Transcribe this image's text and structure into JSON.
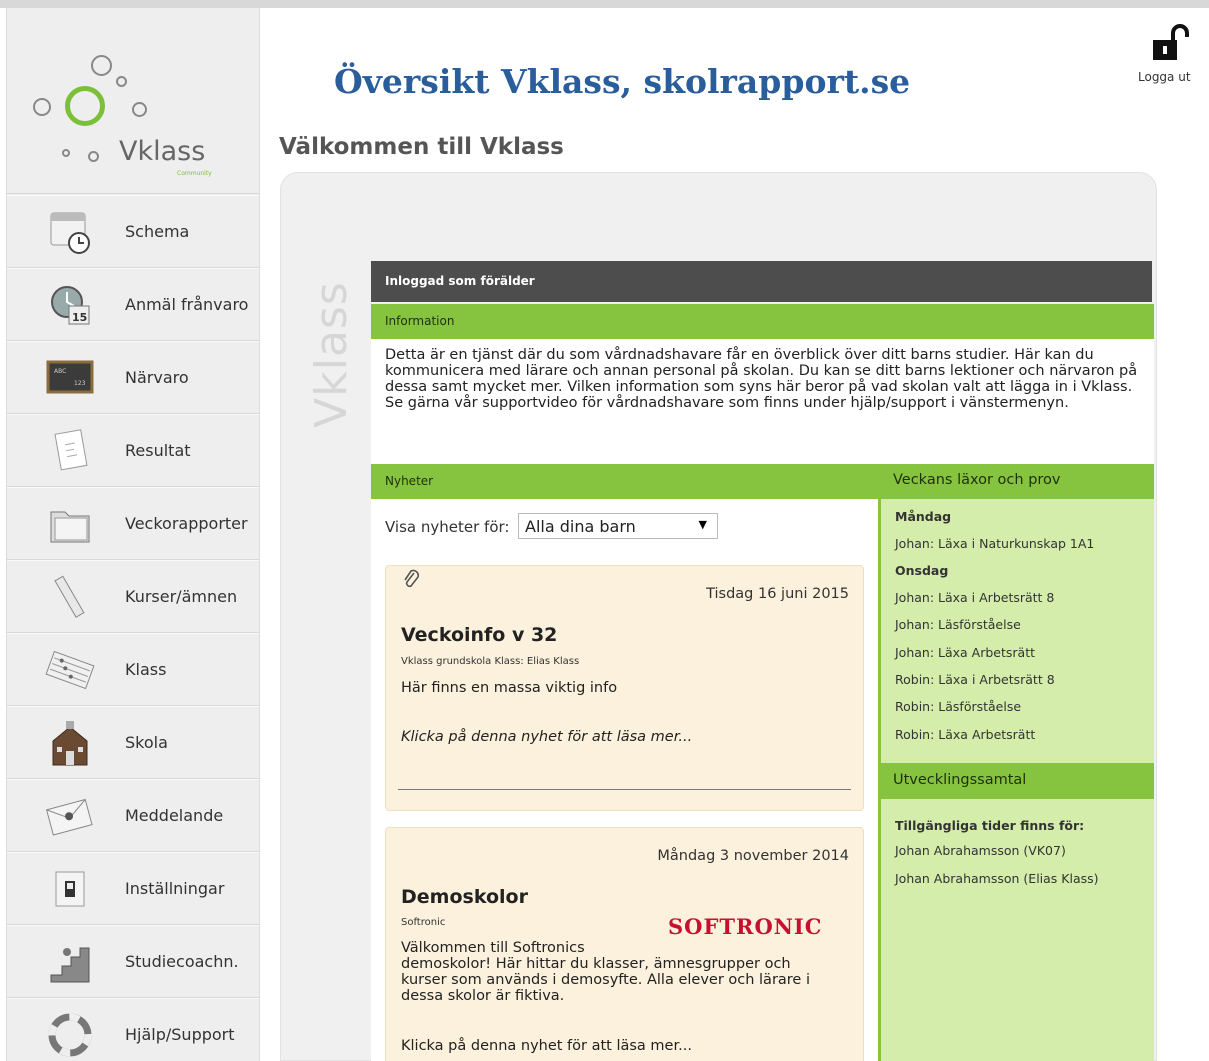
{
  "sidebar": {
    "logo_text": "Vklass",
    "logo_sub": "Community",
    "items": [
      {
        "label": "Schema",
        "icon": "calendar-clock-icon"
      },
      {
        "label": "Anmäl frånvaro",
        "icon": "clock-calendar-icon"
      },
      {
        "label": "Närvaro",
        "icon": "blackboard-icon"
      },
      {
        "label": "Resultat",
        "icon": "document-icon"
      },
      {
        "label": "Veckorapporter",
        "icon": "folder-icon"
      },
      {
        "label": "Kurser/ämnen",
        "icon": "ruler-icon"
      },
      {
        "label": "Klass",
        "icon": "abacus-icon"
      },
      {
        "label": "Skola",
        "icon": "school-icon"
      },
      {
        "label": "Meddelande",
        "icon": "envelope-icon"
      },
      {
        "label": "Inställningar",
        "icon": "switch-icon"
      },
      {
        "label": "Studiecoachn.",
        "icon": "stairs-icon"
      },
      {
        "label": "Hjälp/Support",
        "icon": "lifebuoy-icon"
      }
    ]
  },
  "header": {
    "title": "Översikt Vklass, skolrapport.se",
    "welcome": "Välkommen till Vklass",
    "logout_label": "Logga ut"
  },
  "panel": {
    "side_text": "Vklass",
    "logged_in_as": "Inloggad som förälder",
    "info_title": "Information",
    "info_text": "Detta är en tjänst där du som vårdnadshavare får en överblick över ditt barns studier. Här kan du kommunicera med lärare och annan personal på skolan. Du kan se ditt barns lektioner och närvaron på dessa samt mycket mer. Vilken information som syns här beror på vad skolan valt att lägga in i Vklass. Se gärna vår supportvideo för vårdnadshavare som finns under hjälp/support i vänstermenyn."
  },
  "news": {
    "header": "Nyheter",
    "filter_label": "Visa nyheter för:",
    "filter_value": "Alla dina barn",
    "items": [
      {
        "date": "Tisdag 16 juni 2015",
        "title": "Veckoinfo v 32",
        "meta": "Vklass grundskola Klass: Elias Klass",
        "body": "Här finns en massa viktig info",
        "more": "Klicka på denna nyhet för att läsa mer..."
      },
      {
        "date": "Måndag 3 november 2014",
        "title": "Demoskolor",
        "meta": "Softronic",
        "logo": "SOFTRONIC",
        "body_lines": [
          "Välkommen till Softronics",
          "demoskolor! Här hittar du klasser, ämnesgrupper och",
          "kurser som används i demosyfte. Alla elever och lärare i",
          "dessa skolor är fiktiva."
        ],
        "more": "Klicka på denna nyhet för att läsa mer..."
      }
    ]
  },
  "homework": {
    "header": "Veckans läxor och prov",
    "rows": [
      {
        "text": "Måndag",
        "day": true
      },
      {
        "text": "Johan: Läxa i Naturkunskap 1A1",
        "day": false
      },
      {
        "text": "Onsdag",
        "day": true
      },
      {
        "text": "Johan: Läxa i Arbetsrätt 8",
        "day": false
      },
      {
        "text": "Johan: Läsförståelse",
        "day": false
      },
      {
        "text": "Johan: Läxa Arbetsrätt",
        "day": false
      },
      {
        "text": "Robin: Läxa i Arbetsrätt 8",
        "day": false
      },
      {
        "text": "Robin: Läsförståelse",
        "day": false
      },
      {
        "text": "Robin: Läxa Arbetsrätt",
        "day": false
      }
    ]
  },
  "development": {
    "header": "Utvecklingssamtal",
    "available_label": "Tillgängliga tider finns för:",
    "rows": [
      "Johan Abrahamsson (VK07)",
      "Johan Abrahamsson (Elias Klass)"
    ]
  },
  "colors": {
    "accent_green": "#86c440",
    "light_green": "#d4edaa",
    "title_blue": "#2a5d9c",
    "dark_bar": "#4d4d4d",
    "card_bg": "#fcf1dc"
  }
}
